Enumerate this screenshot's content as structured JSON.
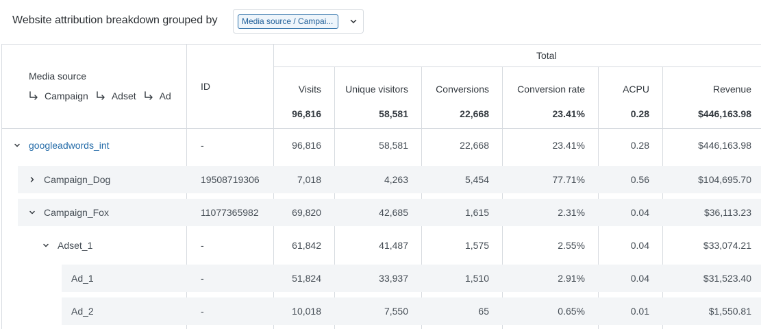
{
  "header": {
    "title": "Website attribution breakdown grouped by",
    "group_by_value": "Media source / Campai..."
  },
  "table": {
    "group_header": "Total",
    "dimension_header": "Media source",
    "dimension_path": [
      "Campaign",
      "Adset",
      "Ad"
    ],
    "id_header": "ID",
    "columns": [
      "Visits",
      "Unique visitors",
      "Conversions",
      "Conversion rate",
      "ACPU",
      "Revenue"
    ],
    "totals": [
      "96,816",
      "58,581",
      "22,668",
      "23.41%",
      "0.28",
      "$446,163.98"
    ],
    "rows": [
      {
        "name": "googleadwords_int",
        "id": "-",
        "expanded": true,
        "level": 0,
        "values": [
          "96,816",
          "58,581",
          "22,668",
          "23.41%",
          "0.28",
          "$446,163.98"
        ]
      },
      {
        "name": "Campaign_Dog",
        "id": "19508719306",
        "expanded": false,
        "level": 1,
        "values": [
          "7,018",
          "4,263",
          "5,454",
          "77.71%",
          "0.56",
          "$104,695.70"
        ]
      },
      {
        "name": "Campaign_Fox",
        "id": "11077365982",
        "expanded": true,
        "level": 1,
        "values": [
          "69,820",
          "42,685",
          "1,615",
          "2.31%",
          "0.04",
          "$36,113.23"
        ]
      },
      {
        "name": "Adset_1",
        "id": "-",
        "expanded": true,
        "level": 2,
        "values": [
          "61,842",
          "41,487",
          "1,575",
          "2.55%",
          "0.04",
          "$33,074.21"
        ]
      },
      {
        "name": "Ad_1",
        "id": "-",
        "level": 3,
        "values": [
          "51,824",
          "33,937",
          "1,510",
          "2.91%",
          "0.04",
          "$31,523.40"
        ]
      },
      {
        "name": "Ad_2",
        "id": "-",
        "level": 3,
        "values": [
          "10,018",
          "7,550",
          "65",
          "0.65%",
          "0.01",
          "$1,550.81"
        ]
      }
    ]
  },
  "colors": {
    "link": "#236ba8",
    "border": "#d7dbe0",
    "row_stripe": "#f3f5f7",
    "chip_border": "#2d6fa8"
  }
}
